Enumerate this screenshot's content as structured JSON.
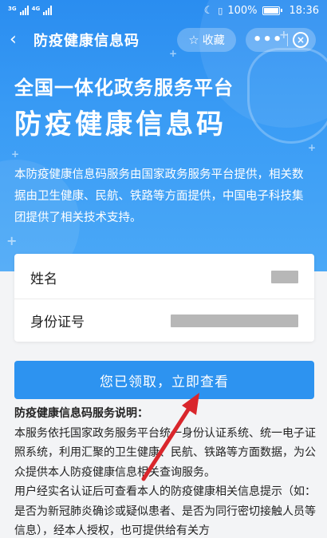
{
  "status_bar": {
    "network_1": "3G",
    "network_2": "4G",
    "battery_text": "100%",
    "time": "18:36"
  },
  "nav": {
    "title": "防疫健康信息码",
    "collect_label": "收藏",
    "more_label": "•••"
  },
  "hero": {
    "title_line1": "全国一体化政务服务平台",
    "title_line2": "防疫健康信息码",
    "description": "本防疫健康信息码服务由国家政务服务平台提供，相关数据由卫生健康、民航、铁路等方面提供，中国电子科技集团提供了相关技术支持。"
  },
  "info": {
    "name_label": "姓名",
    "id_label": "身份证号"
  },
  "main_button": {
    "label": "您已领取，立即查看"
  },
  "explanation": {
    "title": "防疫健康信息码服务说明：",
    "paragraph1": "本服务依托国家政务服务平台统一身份认证系统、统一电子证照系统，利用汇聚的卫生健康、民航、铁路等方面数据，为公众提供本人防疫健康信息相关查询服务。",
    "paragraph2": "用户经实名认证后可查看本人的防疫健康相关信息提示（如：是否为新冠肺炎确诊或疑似患者、是否为同行密切接触人员等信息），经本人授权，也可提供给有关方"
  },
  "colors": {
    "primary_blue": "#2d93f0",
    "annotation_red": "#d9262c"
  }
}
